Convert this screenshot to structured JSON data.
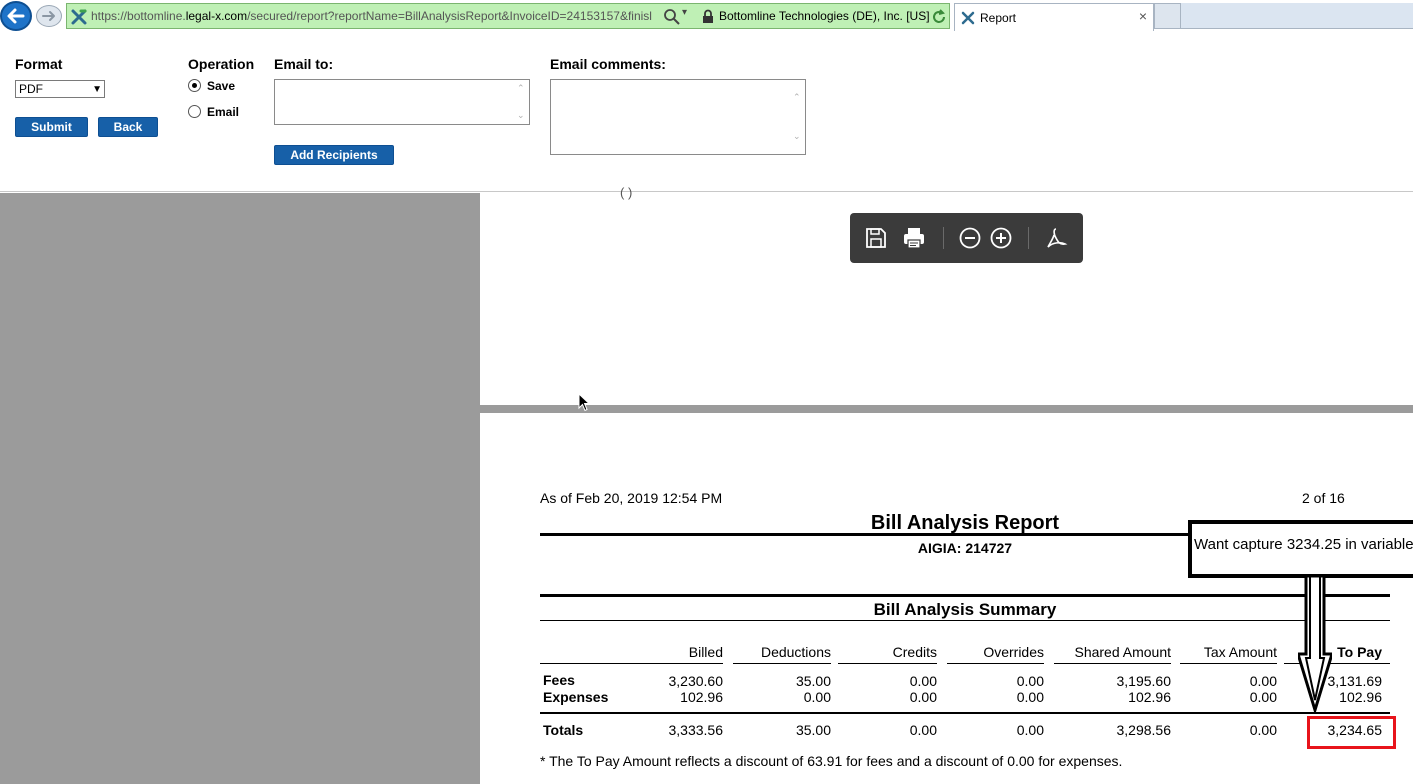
{
  "browser": {
    "url_prefix": "https://bottomline.",
    "url_domain": "legal-x.com",
    "url_path": "/secured/report?reportName=BillAnalysisReport&InvoiceID=24153157&finisl",
    "site_identity": "Bottomline Technologies (DE), Inc. [US]",
    "tab_title": "Report",
    "tab_close": "×"
  },
  "form": {
    "format_label": "Format",
    "format_value": "PDF",
    "operation_label": "Operation",
    "op_save": "Save",
    "op_email": "Email",
    "email_to_label": "Email to:",
    "email_to_value": "",
    "email_comments_label": "Email comments:",
    "email_comments_value": "",
    "submit": "Submit",
    "back": "Back",
    "add_recipients": "Add Recipients"
  },
  "report": {
    "page1_fragment": "(                    )",
    "as_of": "As of Feb 20, 2019 12:54 PM",
    "page_indicator": "2 of 16",
    "title": "Bill Analysis Report",
    "client": "AIGIA: 214727",
    "summary_title": "Bill Analysis Summary",
    "columns": [
      "Billed",
      "Deductions",
      "Credits",
      "Overrides",
      "Shared Amount",
      "Tax Amount",
      "To Pay"
    ],
    "rows": [
      {
        "label": "Fees",
        "values": [
          "3,230.60",
          "35.00",
          "0.00",
          "0.00",
          "3,195.60",
          "0.00",
          "3,131.69"
        ]
      },
      {
        "label": "Expenses",
        "values": [
          "102.96",
          "0.00",
          "0.00",
          "0.00",
          "102.96",
          "0.00",
          "102.96"
        ]
      }
    ],
    "totals": {
      "label": "Totals",
      "values": [
        "3,333.56",
        "35.00",
        "0.00",
        "0.00",
        "3,298.56",
        "0.00",
        "3,234.65"
      ]
    },
    "note": "* The To Pay Amount reflects a discount of 63.91 for fees and a discount of 0.00 for expenses."
  },
  "annotation": {
    "text": "Want capture 3234.25 in variable",
    "highlight_color": "#e8141b"
  }
}
